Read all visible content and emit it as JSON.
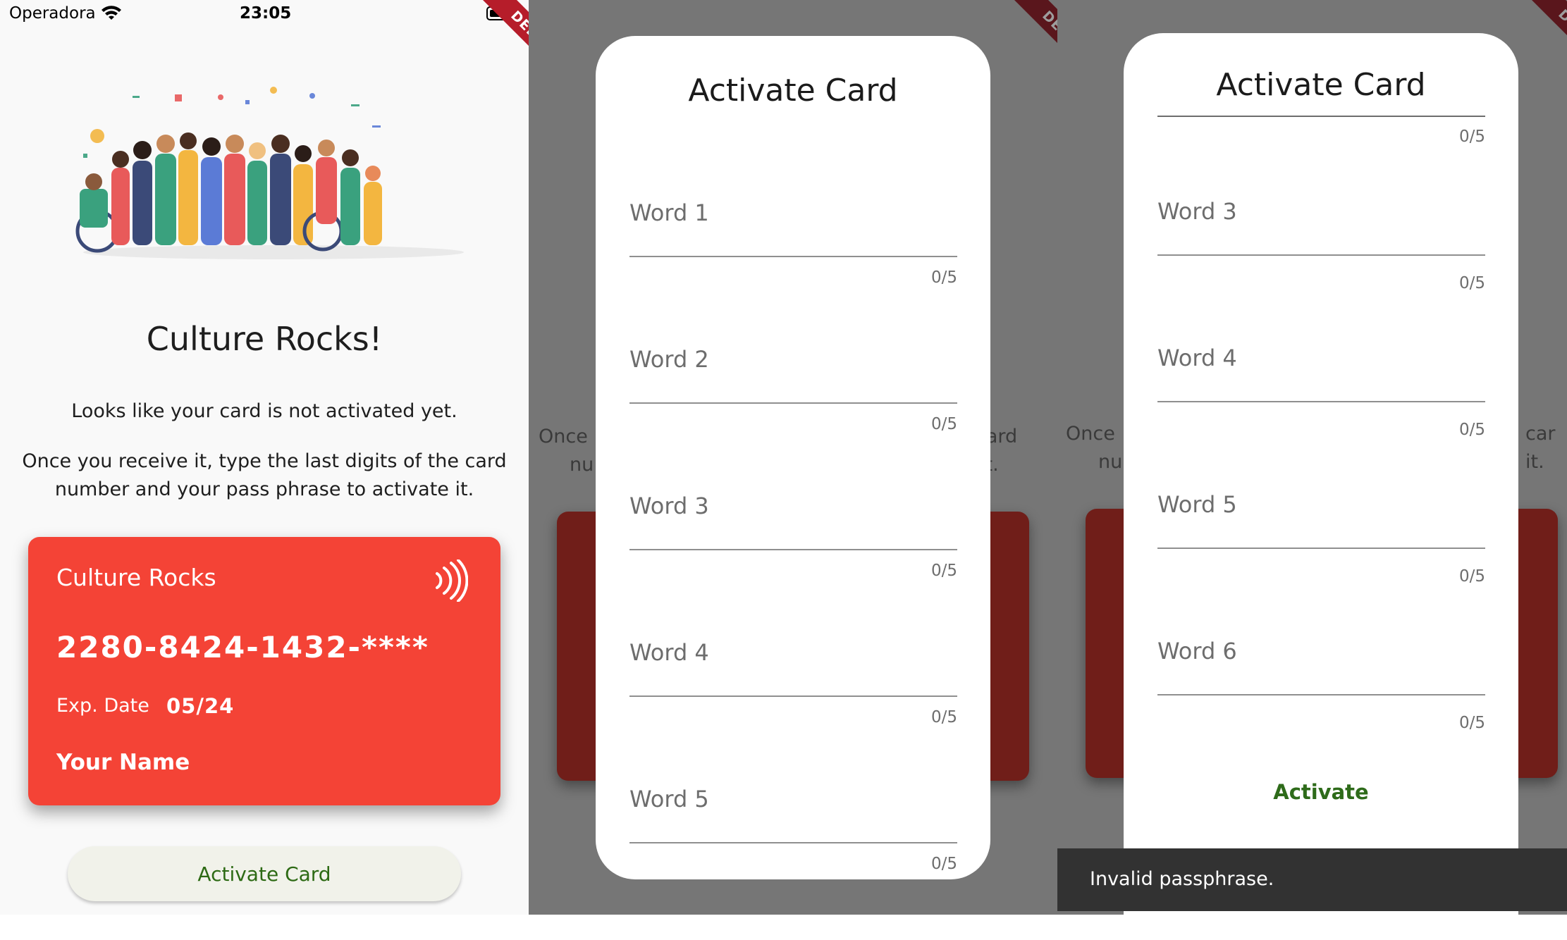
{
  "status_bar": {
    "carrier": "Operadora",
    "time": "23:05"
  },
  "debug_banner": "DEBUG",
  "home": {
    "title": "Culture Rocks!",
    "line1": "Looks like your card is not activated yet.",
    "line2": "Once you receive it, type the last digits of the card number and your pass phrase to activate it.",
    "card": {
      "brand": "Culture Rocks",
      "number": "2280-8424-1432-****",
      "exp_label": "Exp. Date",
      "exp_value": "05/24",
      "holder": "Your Name",
      "color": "#f44336"
    },
    "activate_button": "Activate Card",
    "illustration": "crowd-of-diverse-people-celebrating"
  },
  "background_fragments": {
    "once": "Once",
    "nu": "nu",
    "card_word": "card",
    "it": "it.",
    "card_word_s3": "car",
    "it_s3": "it."
  },
  "dialog_left": {
    "title": "Activate Card",
    "fields": [
      {
        "label": "Word 1",
        "counter": "0/5"
      },
      {
        "label": "Word 2",
        "counter": "0/5"
      },
      {
        "label": "Word 3",
        "counter": "0/5"
      },
      {
        "label": "Word 4",
        "counter": "0/5"
      },
      {
        "label": "Word 5",
        "counter": "0/5"
      }
    ]
  },
  "dialog_right": {
    "title": "Activate Card",
    "top_counter": "0/5",
    "fields": [
      {
        "label": "Word 3",
        "counter": "0/5"
      },
      {
        "label": "Word 4",
        "counter": "0/5"
      },
      {
        "label": "Word 5",
        "counter": "0/5"
      },
      {
        "label": "Word 6",
        "counter": "0/5"
      }
    ],
    "action": "Activate"
  },
  "snackbar": {
    "message": "Invalid passphrase."
  },
  "colors": {
    "accent_green": "#2e6b1a",
    "card_red": "#f44336",
    "scrim": "#767676",
    "snackbar": "#323232"
  }
}
